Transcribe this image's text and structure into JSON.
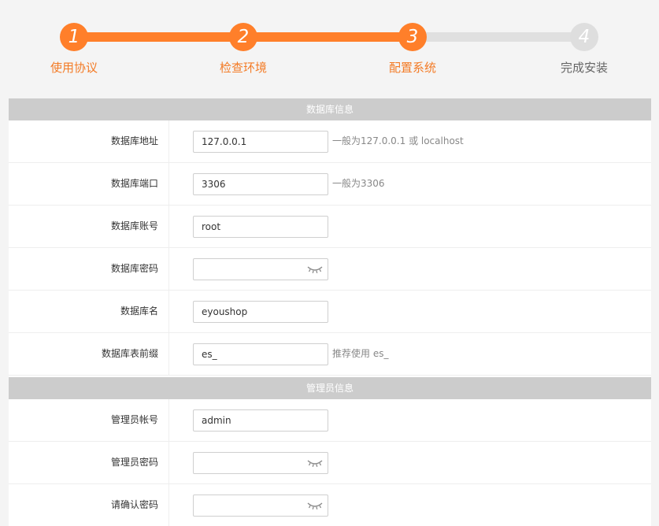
{
  "steps": [
    {
      "num": "1",
      "label": "使用协议",
      "state": "done"
    },
    {
      "num": "2",
      "label": "检查环境",
      "state": "done"
    },
    {
      "num": "3",
      "label": "配置系统",
      "state": "done"
    },
    {
      "num": "4",
      "label": "完成安装",
      "state": "todo"
    }
  ],
  "db_section": {
    "title": "数据库信息",
    "rows": [
      {
        "label": "数据库地址",
        "value": "127.0.0.1",
        "hint": "一般为127.0.0.1 或 localhost"
      },
      {
        "label": "数据库端口",
        "value": "3306",
        "hint": "一般为3306"
      },
      {
        "label": "数据库账号",
        "value": "root",
        "hint": ""
      },
      {
        "label": "数据库密码",
        "value": "",
        "hint": ""
      },
      {
        "label": "数据库名",
        "value": "eyoushop",
        "hint": ""
      },
      {
        "label": "数据库表前缀",
        "value": "es_",
        "hint": "推荐使用 es_"
      }
    ]
  },
  "admin_section": {
    "title": "管理员信息",
    "rows": [
      {
        "label": "管理员帐号",
        "value": "admin"
      },
      {
        "label": "管理员密码",
        "value": ""
      },
      {
        "label": "请确认密码",
        "value": ""
      }
    ]
  },
  "icons": {
    "password_toggle": "eye-closed-icon"
  },
  "colors": {
    "accent": "#ff7f2a",
    "inactive": "#dedede",
    "section_header": "#cccccc"
  }
}
